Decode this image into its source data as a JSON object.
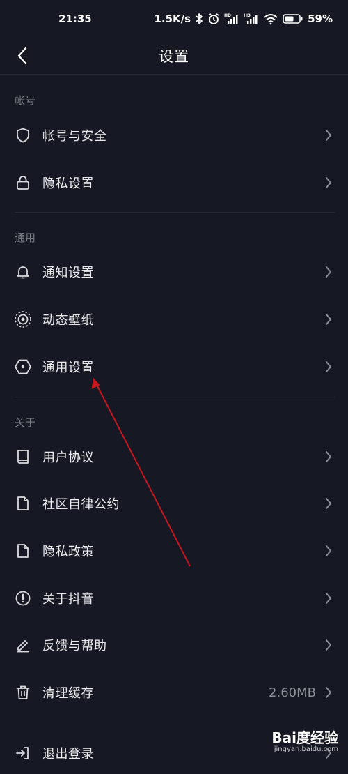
{
  "status_bar": {
    "time": "21:35",
    "speed": "1.5K/s",
    "battery": "59%",
    "icons": [
      "bluetooth-icon",
      "alarm-icon",
      "signal-hd-icon",
      "signal-hd-icon",
      "wifi-icon",
      "battery-icon"
    ]
  },
  "header": {
    "title": "设置",
    "back_icon": "back-arrow-icon"
  },
  "sections": [
    {
      "title": "帐号",
      "items": [
        {
          "label": "帐号与安全",
          "icon": "shield-icon"
        },
        {
          "label": "隐私设置",
          "icon": "lock-icon"
        }
      ]
    },
    {
      "title": "通用",
      "items": [
        {
          "label": "通知设置",
          "icon": "bell-icon"
        },
        {
          "label": "动态壁纸",
          "icon": "live-wallpaper-icon"
        },
        {
          "label": "通用设置",
          "icon": "hexagon-settings-icon"
        }
      ]
    },
    {
      "title": "关于",
      "items": [
        {
          "label": "用户协议",
          "icon": "book-icon"
        },
        {
          "label": "社区自律公约",
          "icon": "document-icon"
        },
        {
          "label": "隐私政策",
          "icon": "document-icon"
        },
        {
          "label": "关于抖音",
          "icon": "info-icon"
        },
        {
          "label": "反馈与帮助",
          "icon": "pencil-icon"
        },
        {
          "label": "清理缓存",
          "icon": "trash-icon",
          "value": "2.60MB"
        },
        {
          "label": "退出登录",
          "icon": "logout-icon"
        }
      ]
    }
  ],
  "colors": {
    "background": "#161823",
    "text": "#ebebee",
    "muted": "#7d7f88",
    "annotation_arrow": "#c8161d"
  },
  "watermark": {
    "logo": "Bai度经验",
    "url": "jingyan.baidu.com"
  }
}
